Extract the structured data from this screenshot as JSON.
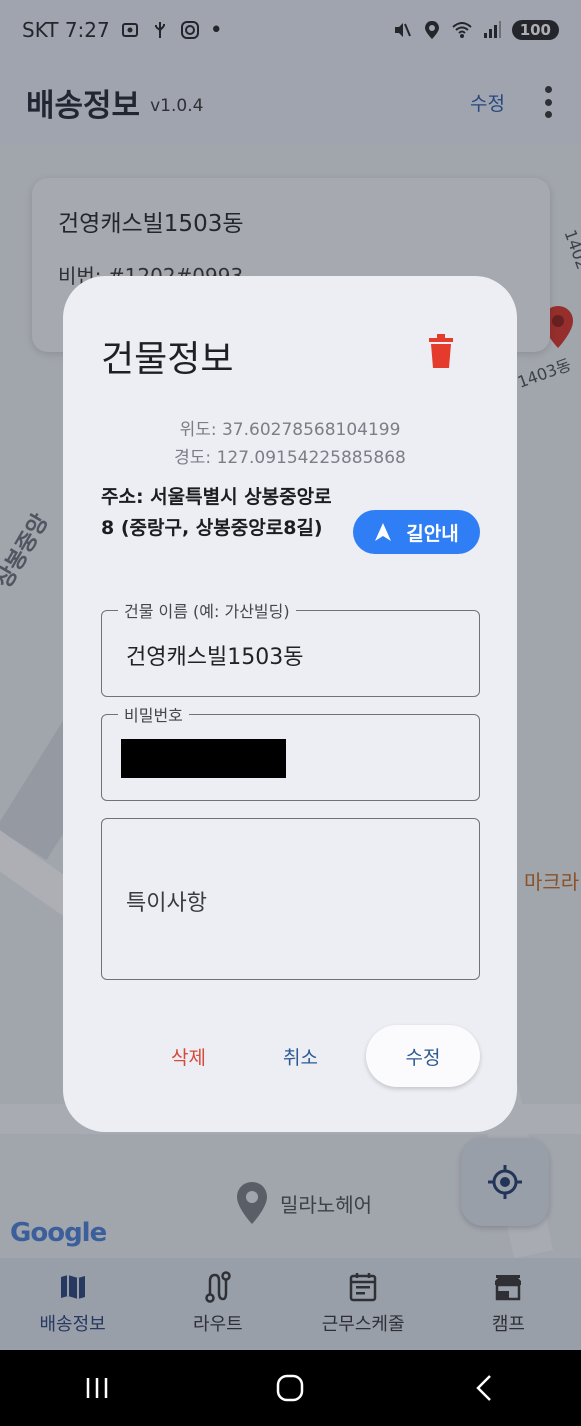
{
  "status_bar": {
    "carrier_time": "SKT 7:27",
    "icons_left": [
      "screenshot-icon",
      "usb-icon",
      "instagram-icon",
      "dot-icon"
    ],
    "icons_right": [
      "mute-vibrate-icon",
      "location-icon",
      "wifi-icon",
      "signal-icon"
    ],
    "battery": "100"
  },
  "app_bar": {
    "title": "배송정보",
    "version": "v1.0.4",
    "edit_label": "수정"
  },
  "map": {
    "info_card": {
      "name": "건영캐스빌1503동",
      "password": "비번: #1202#0993"
    },
    "road_label": "상봉중앙",
    "poi_milano": "밀라노헤어",
    "poi_orange": "마크라",
    "pin_label_1": "1402",
    "pin_label_2": "1403동",
    "google_logo": "Google"
  },
  "dialog": {
    "title": "건물정보",
    "latitude": "위도: 37.60278568104199",
    "longitude": "경도: 127.09154225885868",
    "address": "주소: 서울특별시  상봉중앙로 8 (중랑구, 상봉중앙로8길)",
    "nav_button": "길안내",
    "building_name_label": "건물 이름 (예: 가산빌딩)",
    "building_name_value": "건영캐스빌1503동",
    "password_label": "비밀번호",
    "notes_placeholder": "특이사항",
    "delete_label": "삭제",
    "cancel_label": "취소",
    "save_label": "수정"
  },
  "bottom_nav": {
    "items": [
      {
        "label": "배송정보",
        "icon": "map-icon",
        "active": true
      },
      {
        "label": "라우트",
        "icon": "route-icon",
        "active": false
      },
      {
        "label": "근무스케줄",
        "icon": "calendar-icon",
        "active": false
      },
      {
        "label": "캠프",
        "icon": "store-icon",
        "active": false
      }
    ]
  },
  "colors": {
    "accent": "#2f7ef5",
    "danger": "#d64a3a",
    "primary_text": "#2e5a94"
  }
}
